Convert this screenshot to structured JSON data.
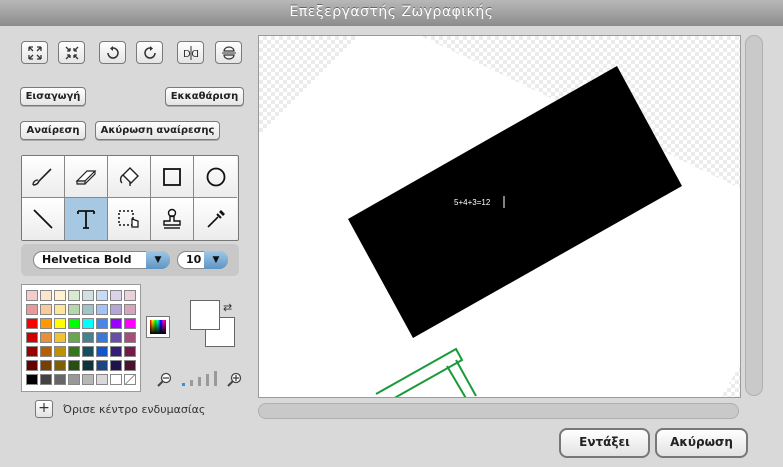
{
  "window": {
    "title": "Επεξεργαστής Ζωγραφικής"
  },
  "transform_toolbar": [
    {
      "name": "grow-icon"
    },
    {
      "name": "shrink-icon"
    },
    {
      "name": "rotate-ccw-icon"
    },
    {
      "name": "rotate-cw-icon"
    },
    {
      "name": "flip-horizontal-icon"
    },
    {
      "name": "flip-vertical-icon"
    }
  ],
  "buttons": {
    "import": "Εισαγωγή",
    "clear": "Εκκαθάριση",
    "undo": "Αναίρεση",
    "redo": "Ακύρωση αναίρεσης",
    "ok": "Εντάξει",
    "cancel": "Ακύρωση"
  },
  "tools": [
    {
      "name": "paintbrush-tool",
      "icon": "paintbrush-icon",
      "selected": false
    },
    {
      "name": "eraser-tool",
      "icon": "eraser-icon",
      "selected": false
    },
    {
      "name": "fill-tool",
      "icon": "paint-bucket-icon",
      "selected": false
    },
    {
      "name": "rectangle-tool",
      "icon": "rectangle-icon",
      "selected": false
    },
    {
      "name": "ellipse-tool",
      "icon": "ellipse-icon",
      "selected": false
    },
    {
      "name": "line-tool",
      "icon": "line-icon",
      "selected": false
    },
    {
      "name": "text-tool",
      "icon": "text-icon",
      "selected": true
    },
    {
      "name": "select-tool",
      "icon": "select-icon",
      "selected": false
    },
    {
      "name": "stamp-tool",
      "icon": "stamp-icon",
      "selected": false
    },
    {
      "name": "eyedropper-tool",
      "icon": "eyedropper-icon",
      "selected": false
    }
  ],
  "font": {
    "family": "Helvetica Bold",
    "size": "10"
  },
  "palette": {
    "rows": [
      [
        "#f4cccc",
        "#fce5cd",
        "#fff2cc",
        "#d9ead3",
        "#d0e0e3",
        "#c9daf8",
        "#d9d2e9",
        "#ead1dc"
      ],
      [
        "#ea9999",
        "#f9cb9c",
        "#ffe599",
        "#b6d7a8",
        "#a2c4c9",
        "#a4c2f4",
        "#b4a7d6",
        "#d5a6bd"
      ],
      [
        "#ff0000",
        "#ff9900",
        "#ffff00",
        "#00ff00",
        "#00ffff",
        "#4a86e8",
        "#9900ff",
        "#ff00ff"
      ],
      [
        "#cc0000",
        "#e69138",
        "#f1c232",
        "#6aa84f",
        "#45818e",
        "#3c78d8",
        "#674ea7",
        "#a64d79"
      ],
      [
        "#990000",
        "#b45f06",
        "#bf9000",
        "#38761d",
        "#134f5c",
        "#1155cc",
        "#351c75",
        "#741b47"
      ],
      [
        "#660000",
        "#783f04",
        "#7f6000",
        "#274e13",
        "#0c343d",
        "#1c4587",
        "#20124d",
        "#4c1130"
      ],
      [
        "#000000",
        "#434343",
        "#666666",
        "#999999",
        "#b7b7b7",
        "#d9d9d9",
        "#ffffff",
        "transparent"
      ]
    ],
    "foreground": "#ffffff",
    "background": "#ffffff"
  },
  "zoom": {
    "level": 1,
    "max": 5
  },
  "costume_center_label": "Όρισε κέντρο ενδυμασίας",
  "canvas": {
    "text": "5+4+3=12",
    "black_rect_color": "#000000",
    "outline_color": "#1a9a3a"
  }
}
